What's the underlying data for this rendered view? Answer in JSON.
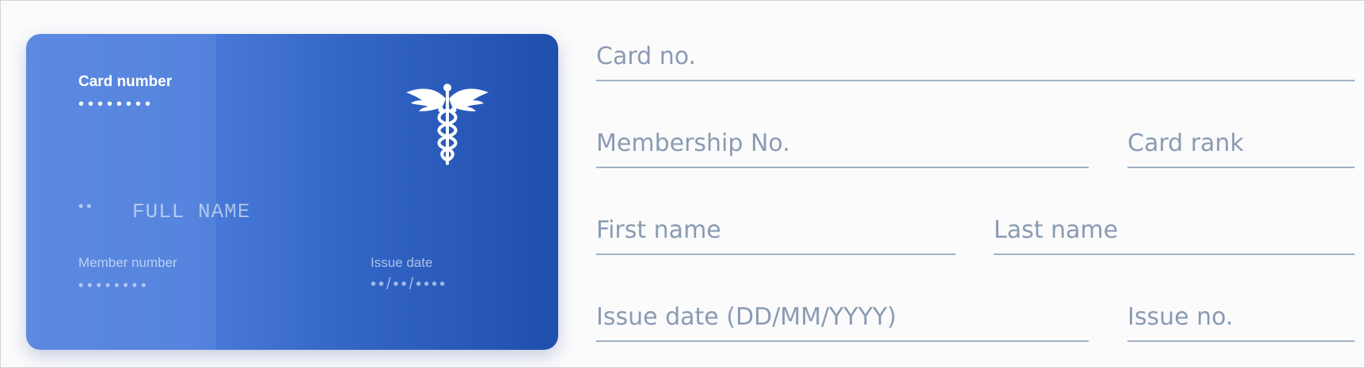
{
  "card": {
    "card_number_label": "Card number",
    "card_number_value": "••••••••",
    "name_dots": "••",
    "full_name": "FULL NAME",
    "member_number_label": "Member number",
    "member_number_value": "••••••••",
    "issue_date_label": "Issue date",
    "issue_date_value": "••/••/••••",
    "logo_icon": "caduceus-icon"
  },
  "form": {
    "card_no": {
      "placeholder": "Card no.",
      "value": ""
    },
    "membership_no": {
      "placeholder": "Membership No.",
      "value": ""
    },
    "card_rank": {
      "placeholder": "Card rank",
      "value": ""
    },
    "first_name": {
      "placeholder": "First name",
      "value": ""
    },
    "last_name": {
      "placeholder": "Last name",
      "value": ""
    },
    "issue_date": {
      "placeholder": "Issue date (DD/MM/YYYY)",
      "value": ""
    },
    "issue_no": {
      "placeholder": "Issue no.",
      "value": ""
    }
  },
  "colors": {
    "card_gradient_start": "#5585e0",
    "card_gradient_end": "#1f4fad",
    "placeholder": "#8a9bb3",
    "underline": "#9fb0c4"
  }
}
